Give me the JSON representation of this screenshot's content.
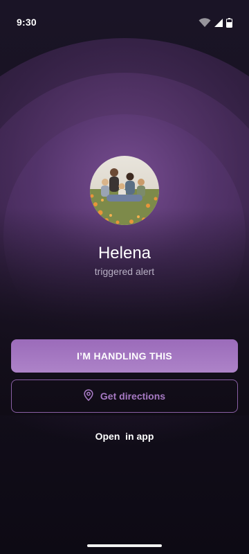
{
  "status_bar": {
    "time": "9:30",
    "icons": [
      "wifi-icon",
      "cellular-signal-icon",
      "battery-icon"
    ]
  },
  "alert": {
    "avatar_icon": "family-photo-avatar",
    "name": "Helena",
    "subtitle": "triggered alert"
  },
  "actions": {
    "primary_label": "I’M HANDLING THIS",
    "directions_label": "Get directions",
    "directions_icon": "location-pin-icon",
    "open_app_label": "Open  in app"
  },
  "colors": {
    "accent": "#9b6bba",
    "accent_text": "#a77ac4",
    "background": "#16111f"
  }
}
